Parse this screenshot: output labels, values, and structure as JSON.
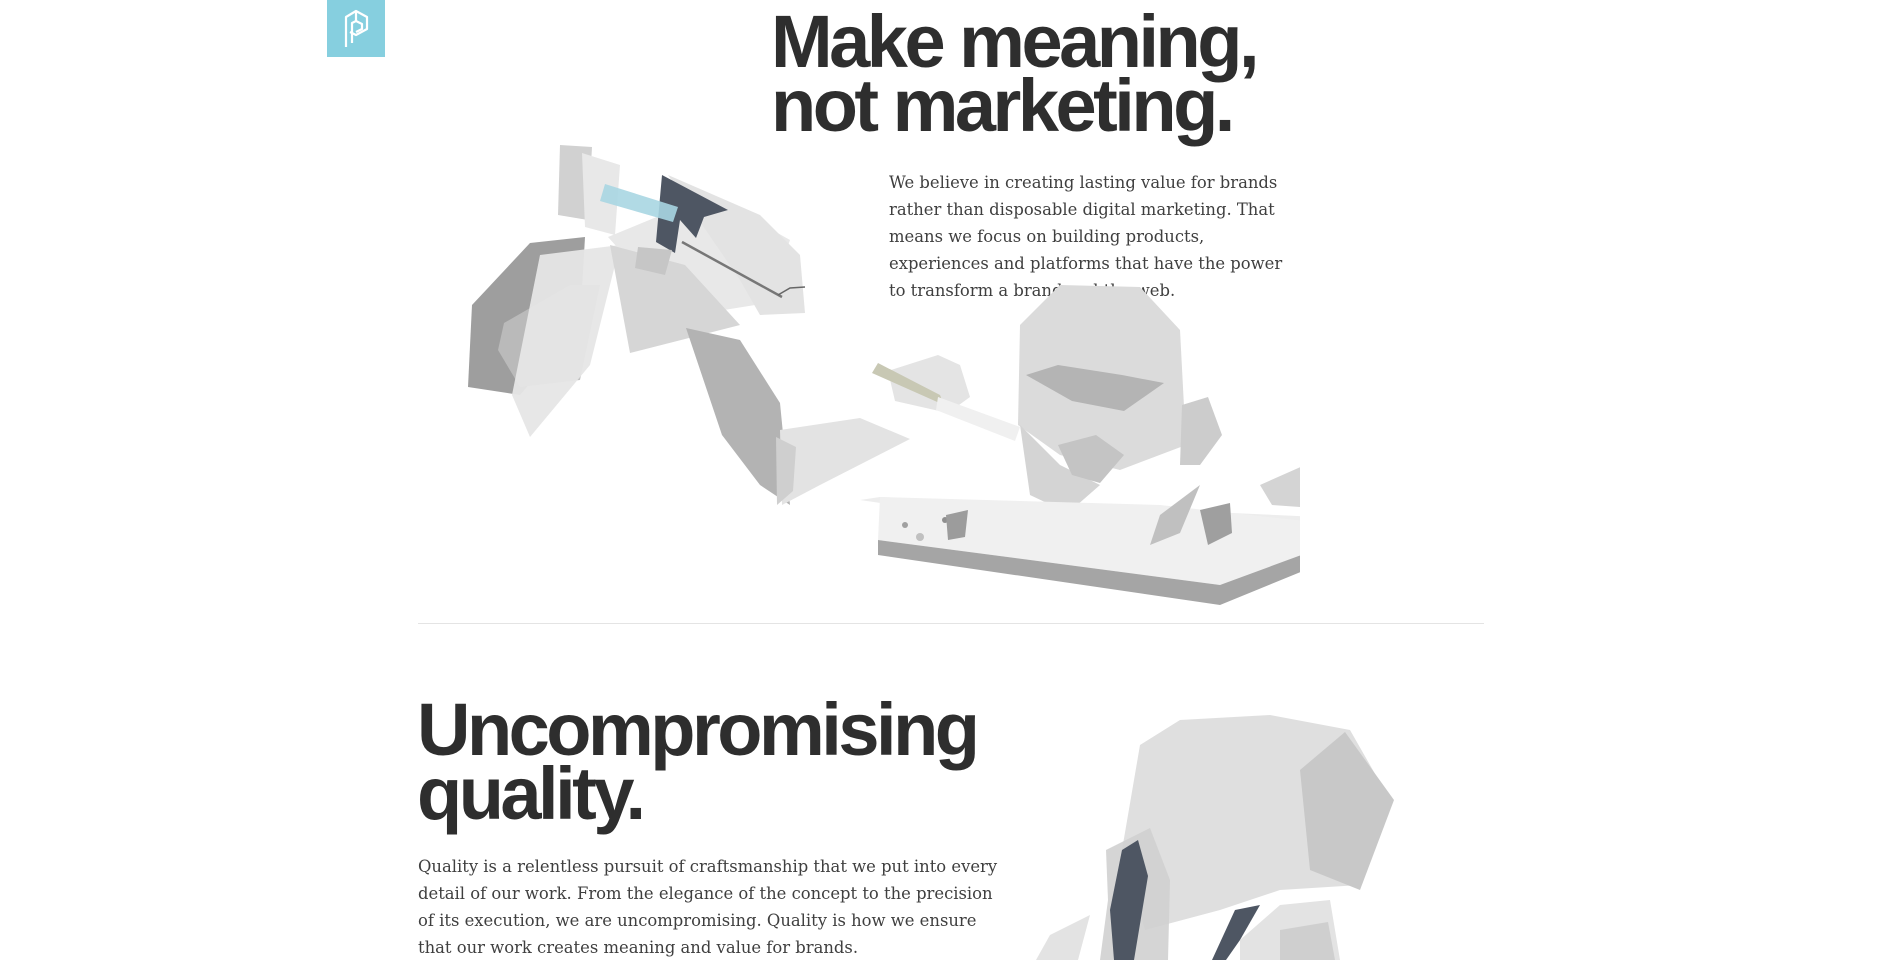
{
  "logo": {
    "icon": "monogram-logo-icon",
    "color": "#86cfdf"
  },
  "hero": {
    "title_line1": "Make meaning,",
    "title_line2": "not marketing.",
    "body": "We believe in creating lasting value for brands rather than disposable digital marketing. That means we focus on building products, experiences and platforms that have the power to transform a brand and the web.",
    "illustration": "sculptor-carving-head-illustration"
  },
  "quality": {
    "title_line1": "Uncompromising",
    "title_line2": "quality.",
    "body": "Quality is a relentless pursuit of craftsmanship that we put into every detail of our work. From the elegance of the concept to the precision of its execution, we are uncompromising. Quality is how we ensure that our work creates meaning and value for brands.",
    "illustration": "polygonal-head-illustration"
  },
  "colors": {
    "text": "#2e2e2e",
    "accent": "#86cfdf",
    "slate": "#4e5663",
    "divider": "#e4e4e4"
  }
}
